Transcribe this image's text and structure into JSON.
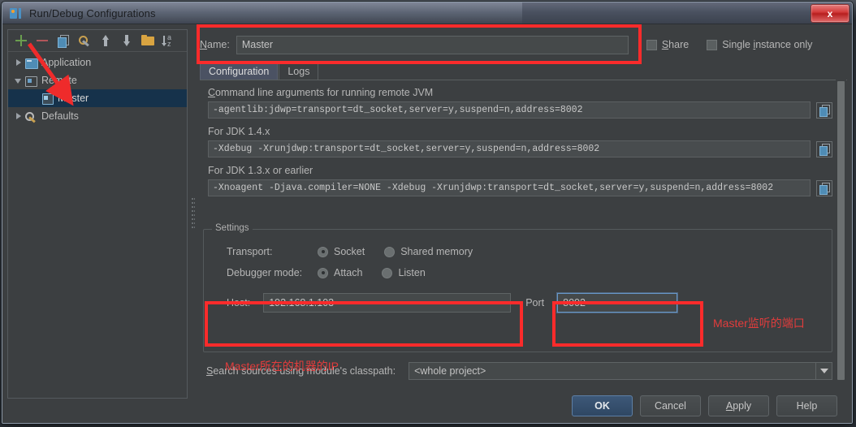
{
  "window": {
    "title": "Run/Debug Configurations",
    "app_icon": "intellij-idea-icon",
    "close_label": "x"
  },
  "toolbar": {
    "icons": [
      {
        "name": "add-icon",
        "label": "+"
      },
      {
        "name": "remove-icon",
        "label": "-"
      },
      {
        "name": "copy-configuration-icon",
        "label": ""
      },
      {
        "name": "edit-templates-icon",
        "label": ""
      },
      {
        "name": "move-up-icon",
        "label": ""
      },
      {
        "name": "move-down-icon",
        "label": ""
      },
      {
        "name": "new-folder-icon",
        "label": ""
      },
      {
        "name": "sort-configurations-icon",
        "label": "az"
      }
    ]
  },
  "tree": {
    "items": [
      {
        "label": "Application",
        "level": 1,
        "twisty": "collapsed",
        "icon": "application-icon",
        "selected": false
      },
      {
        "label": "Remote",
        "level": 1,
        "twisty": "expanded",
        "icon": "remote-icon",
        "selected": false
      },
      {
        "label": "Master",
        "level": 2,
        "twisty": "none",
        "icon": "remote-config-icon",
        "selected": true
      },
      {
        "label": "Defaults",
        "level": 1,
        "twisty": "collapsed",
        "icon": "defaults-icon",
        "selected": false
      }
    ]
  },
  "name_row": {
    "label": "Name:",
    "value": "Master",
    "placeholder": "",
    "share_label": "Share",
    "share_checked": false,
    "single_instance_label": "Single instance only",
    "single_instance_checked": false
  },
  "tabs": [
    {
      "label": "Configuration",
      "active": true
    },
    {
      "label": "Logs",
      "active": false
    }
  ],
  "config": {
    "cmdline_label": "Command line arguments for running remote JVM",
    "cmdline_value": "-agentlib:jdwp=transport=dt_socket,server=y,suspend=n,address=8002",
    "jdk14_label": "For JDK 1.4.x",
    "jdk14_value": "-Xdebug -Xrunjdwp:transport=dt_socket,server=y,suspend=n,address=8002",
    "jdk13_label": "For JDK 1.3.x or earlier",
    "jdk13_value": "-Xnoagent -Djava.compiler=NONE -Xdebug -Xrunjdwp:transport=dt_socket,server=y,suspend=n,address=8002",
    "copy_icon": "copy-to-clipboard-icon"
  },
  "settings": {
    "legend": "Settings",
    "transport_label": "Transport:",
    "transport_options": [
      {
        "label": "Socket",
        "selected": true
      },
      {
        "label": "Shared memory",
        "selected": false
      }
    ],
    "debugger_mode_label": "Debugger mode:",
    "debugger_mode_options": [
      {
        "label": "Attach",
        "selected": true
      },
      {
        "label": "Listen",
        "selected": false
      }
    ],
    "host_label": "Host:",
    "host_value": "192.168.1.103",
    "port_label": "Port",
    "port_value": "8002"
  },
  "search_sources": {
    "label": "Search sources using module's classpath:",
    "value": "<whole project>",
    "dropdown_icon": "chevron-down-icon"
  },
  "buttons": [
    {
      "label": "OK",
      "default": true,
      "mnemonic": ""
    },
    {
      "label": "Cancel",
      "default": false,
      "mnemonic": ""
    },
    {
      "label": "Apply",
      "default": false,
      "mnemonic": "A"
    },
    {
      "label": "Help",
      "default": false,
      "mnemonic": ""
    }
  ],
  "annotations": {
    "port_note": "Master监听的端口",
    "host_note": "Master所在的机器的IP",
    "highlight_color": "#fb2b2b",
    "note_color": "#e23c3c"
  }
}
